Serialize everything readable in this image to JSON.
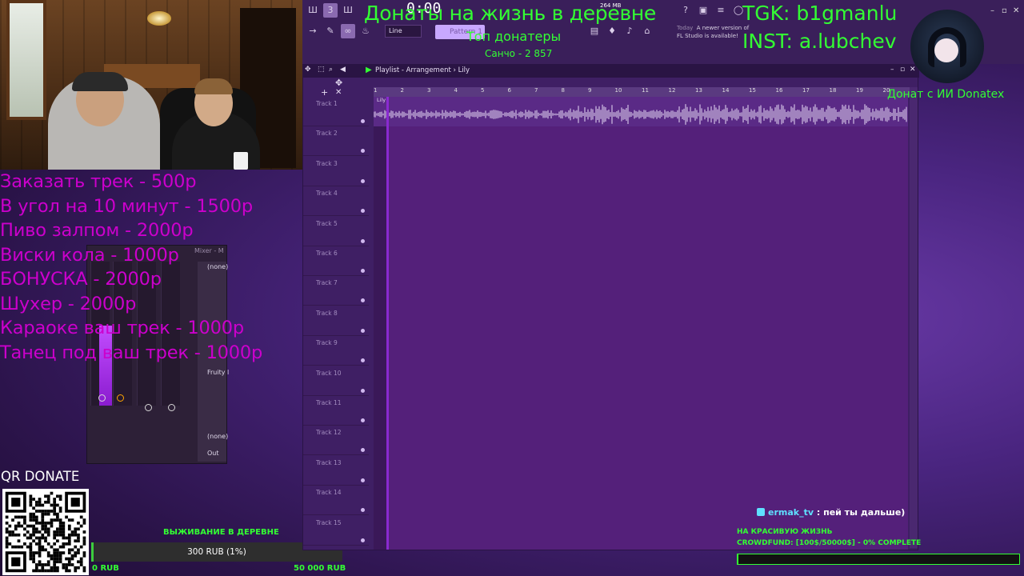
{
  "overlay": {
    "title": "Донаты на жизнь в деревне",
    "top_donors_title": "Топ донатеры",
    "top_donors": [
      "Санчо - 2 857"
    ],
    "tgk": "TGK: b1gmanlu",
    "inst": "INST: a.lubchev",
    "ai_donate": "Донат с ИИ Donatex"
  },
  "donation_menu": [
    "Заказать трек - 500р",
    "В угол на 10 минут - 1500р",
    "Пиво залпом - 2000р",
    "Виски кола - 1000р",
    "БОНУСКА - 2000р",
    "Шухер - 2000р",
    "Караоке ваш трек - 1000р",
    "Танец под ваш трек - 1000р"
  ],
  "qr": {
    "label": "QR DONATE"
  },
  "survival": {
    "title": "ВЫЖИВАНИЕ В ДЕРЕВНЕ",
    "progress_label": "300 RUB (1%)",
    "progress_fraction": 0.01,
    "min_label": "0 RUB",
    "max_label": "50 000 RUB",
    "fill_color": "#3dcc3d"
  },
  "fl": {
    "time": "0:00",
    "memory": "264 MB",
    "snap": "Line",
    "pattern": "Pattern 1",
    "news": [
      "Today",
      "A newer version of",
      "FL Studio is available!"
    ],
    "playlist_caption": "Playlist - Arrangement › Lily",
    "clip_name": "Lily",
    "ruler": [
      "1",
      "2",
      "3",
      "4",
      "5",
      "6",
      "7",
      "8",
      "9",
      "10",
      "11",
      "12",
      "13",
      "14",
      "15",
      "16",
      "17",
      "18",
      "19",
      "20"
    ],
    "tracks": [
      "Track 1",
      "Track 2",
      "Track 3",
      "Track 4",
      "Track 5",
      "Track 6",
      "Track 7",
      "Track 8",
      "Track 9",
      "Track 10",
      "Track 11",
      "Track 12",
      "Track 13",
      "Track 14",
      "Track 15"
    ],
    "mixer_header": "Mixer - M",
    "mixer_items": [
      "(none)",
      "Fruity l",
      "(none)",
      "Out"
    ]
  },
  "chat": {
    "user": "ermak_tv",
    "message": ": пей ты дальше)"
  },
  "crowdfund": {
    "title": "НА КРАСИВУЮ ЖИЗНЬ",
    "status": "CROWDFUND: [100$/50000$] - 0% COMPLETE",
    "fraction": 0.002
  },
  "colors": {
    "accent_green": "#33ff33",
    "menu_magenta": "#cc00cc",
    "playlist_bg": "#54207a"
  }
}
